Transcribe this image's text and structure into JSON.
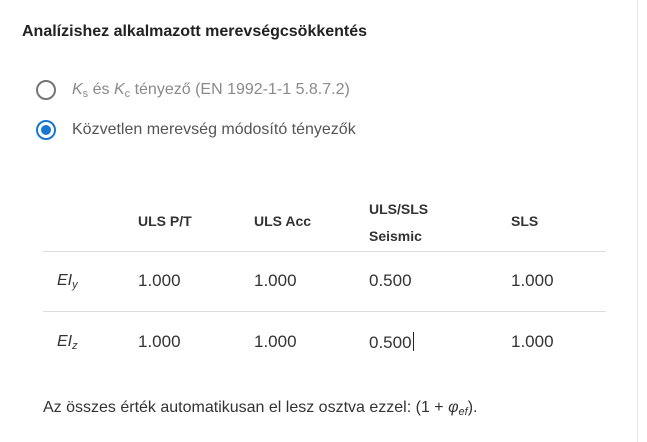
{
  "panel": {
    "title": "Analízishez alkalmazott merevségcsökkentés"
  },
  "options": [
    {
      "prefix_k": "K",
      "sub_s": "s",
      "mid": " és ",
      "prefix_k2": "K",
      "sub_c": "c",
      "rest": " tényező (EN 1992-1-1 5.8.7.2)",
      "selected": false
    },
    {
      "label": "Közvetlen merevség módosító tényezők",
      "selected": true
    }
  ],
  "table": {
    "columns": [
      "ULS P/T",
      "ULS Acc",
      "ULS/SLS",
      "Seismic",
      "SLS"
    ],
    "rows": [
      {
        "label_main": "EI",
        "label_sub": "y",
        "values": [
          "1.000",
          "1.000",
          "0.500",
          "1.000"
        ]
      },
      {
        "label_main": "EI",
        "label_sub": "z",
        "values": [
          "1.000",
          "1.000",
          "0.500",
          "1.000"
        ]
      }
    ]
  },
  "note": {
    "text": "Az összes érték automatikusan el lesz osztva ezzel: (1 + ",
    "phi": "φ",
    "phi_sub": "ef",
    "end": ")."
  },
  "colors": {
    "accent": "#1976d2",
    "radio_off": "#757575",
    "divider": "#dcdcdc"
  }
}
